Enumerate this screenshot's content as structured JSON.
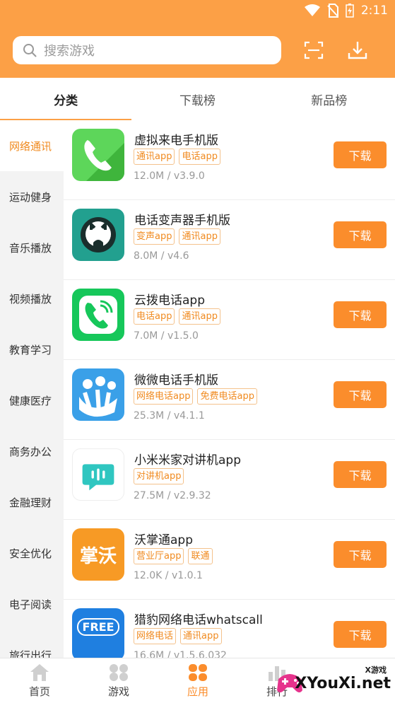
{
  "status_bar": {
    "time": "2:11"
  },
  "search": {
    "placeholder": "搜索游戏"
  },
  "tabs": [
    {
      "label": "分类",
      "active": true
    },
    {
      "label": "下载榜",
      "active": false
    },
    {
      "label": "新品榜",
      "active": false
    }
  ],
  "sidebar": {
    "items": [
      {
        "label": "网络通讯",
        "active": true
      },
      {
        "label": "运动健身"
      },
      {
        "label": "音乐播放"
      },
      {
        "label": "视频播放"
      },
      {
        "label": "教育学习"
      },
      {
        "label": "健康医疗"
      },
      {
        "label": "商务办公"
      },
      {
        "label": "金融理财"
      },
      {
        "label": "安全优化"
      },
      {
        "label": "电子阅读"
      },
      {
        "label": "旅行出行"
      }
    ]
  },
  "apps": [
    {
      "name": "虚拟来电手机版",
      "tags": [
        "通讯app",
        "电话app"
      ],
      "meta": "12.0M / v3.9.0",
      "icon": "phone-handset-green-icon",
      "download_label": "下载"
    },
    {
      "name": "电话变声器手机版",
      "tags": [
        "变声app",
        "通讯app"
      ],
      "meta": "8.0M / v4.6",
      "icon": "voice-changer-teal-icon",
      "download_label": "下载"
    },
    {
      "name": "云拨电话app",
      "tags": [
        "电话app",
        "通讯app"
      ],
      "meta": "7.0M / v1.5.0",
      "icon": "wifi-call-green-icon",
      "download_label": "下载"
    },
    {
      "name": "微微电话手机版",
      "tags": [
        "网络电话app",
        "免费电话app"
      ],
      "meta": "25.3M / v4.1.1",
      "icon": "weiwei-blue-icon",
      "download_label": "下载"
    },
    {
      "name": "小米米家对讲机app",
      "tags": [
        "对讲机app"
      ],
      "meta": "27.5M / v2.9.32",
      "icon": "walkie-talkie-chat-icon",
      "download_label": "下载"
    },
    {
      "name": "沃掌通app",
      "tags": [
        "营业厅app",
        "联通"
      ],
      "meta": "12.0K / v1.0.1",
      "icon": "wozhangtong-orange-icon",
      "icon_text": "掌沃",
      "download_label": "下载"
    },
    {
      "name": "猎豹网络电话whatscall",
      "tags": [
        "网络电话",
        "通讯app"
      ],
      "meta": "16.6M / v1.5.6.032",
      "icon": "free-call-blue-icon",
      "icon_text": "FREE",
      "download_label": "下载"
    }
  ],
  "bottom_nav": [
    {
      "label": "首页",
      "icon": "home-icon"
    },
    {
      "label": "游戏",
      "icon": "game-icon"
    },
    {
      "label": "应用",
      "icon": "apps-icon",
      "active": true
    },
    {
      "label": "排行",
      "icon": "rank-icon"
    }
  ],
  "watermark": {
    "small": "X游戏",
    "text": "XYouXi.net"
  },
  "colors": {
    "brand": "#fca046",
    "button": "#fb8d2c",
    "tag_text": "#f08a1f"
  }
}
